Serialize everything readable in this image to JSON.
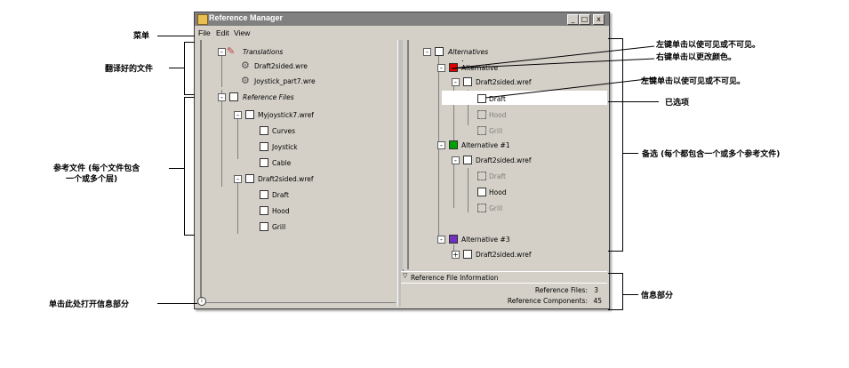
{
  "window": {
    "title": "Reference Manager",
    "buttons": {
      "minimize": "_",
      "maximize": "□",
      "close": "x"
    }
  },
  "menu": {
    "file": "File",
    "edit": "Edit",
    "view": "View"
  },
  "left_tree": {
    "translations": "Translations",
    "translated_files": [
      "Draft2sided.wre",
      "Joystick_part7.wre"
    ],
    "reference_files": "Reference Files",
    "file1": {
      "name": "Myjoystick7.wref",
      "layers": [
        "Curves",
        "Joystick",
        "Cable"
      ]
    },
    "file2": {
      "name": "Draft2sided.wref",
      "layers": [
        "Draft",
        "Hood",
        "Grill"
      ]
    }
  },
  "right_tree": {
    "alternatives": "Alternatives",
    "alt1": {
      "name": "Alternative",
      "color": "#e00000",
      "file": "Draft2sided.wref",
      "layers": [
        "Draft",
        "Hood",
        "Grill"
      ]
    },
    "alt2": {
      "name": "Alternative #1",
      "color": "#00a000",
      "file": "Draft2sided.wref",
      "layers": [
        "Draft",
        "Hood",
        "Grill"
      ]
    },
    "alt3": {
      "name": "Alternative #3",
      "color": "#7030c0",
      "file": "Draft2sided.wref"
    }
  },
  "info": {
    "header": "Reference File Information",
    "ref_files_label": "Reference Files:",
    "ref_files_value": "3",
    "ref_components_label": "Reference Components:",
    "ref_components_value": "45"
  },
  "annotations": {
    "menu": "菜单",
    "translated_files": "翻译好的文件",
    "reference_files_1": "参考文件 (每个文件包含",
    "reference_files_2": "一个或多个层)",
    "open_info": "单击此处打开信息部分",
    "left_click_1": "左键单击以使可见或不可见。",
    "right_click": "右键单击以更改颜色。",
    "left_click_2": "左键单击以使可见或不可见。",
    "selected": "已选项",
    "alternatives": "备选 (每个都包含一个或多个参考文件)",
    "info_section": "信息部分"
  }
}
